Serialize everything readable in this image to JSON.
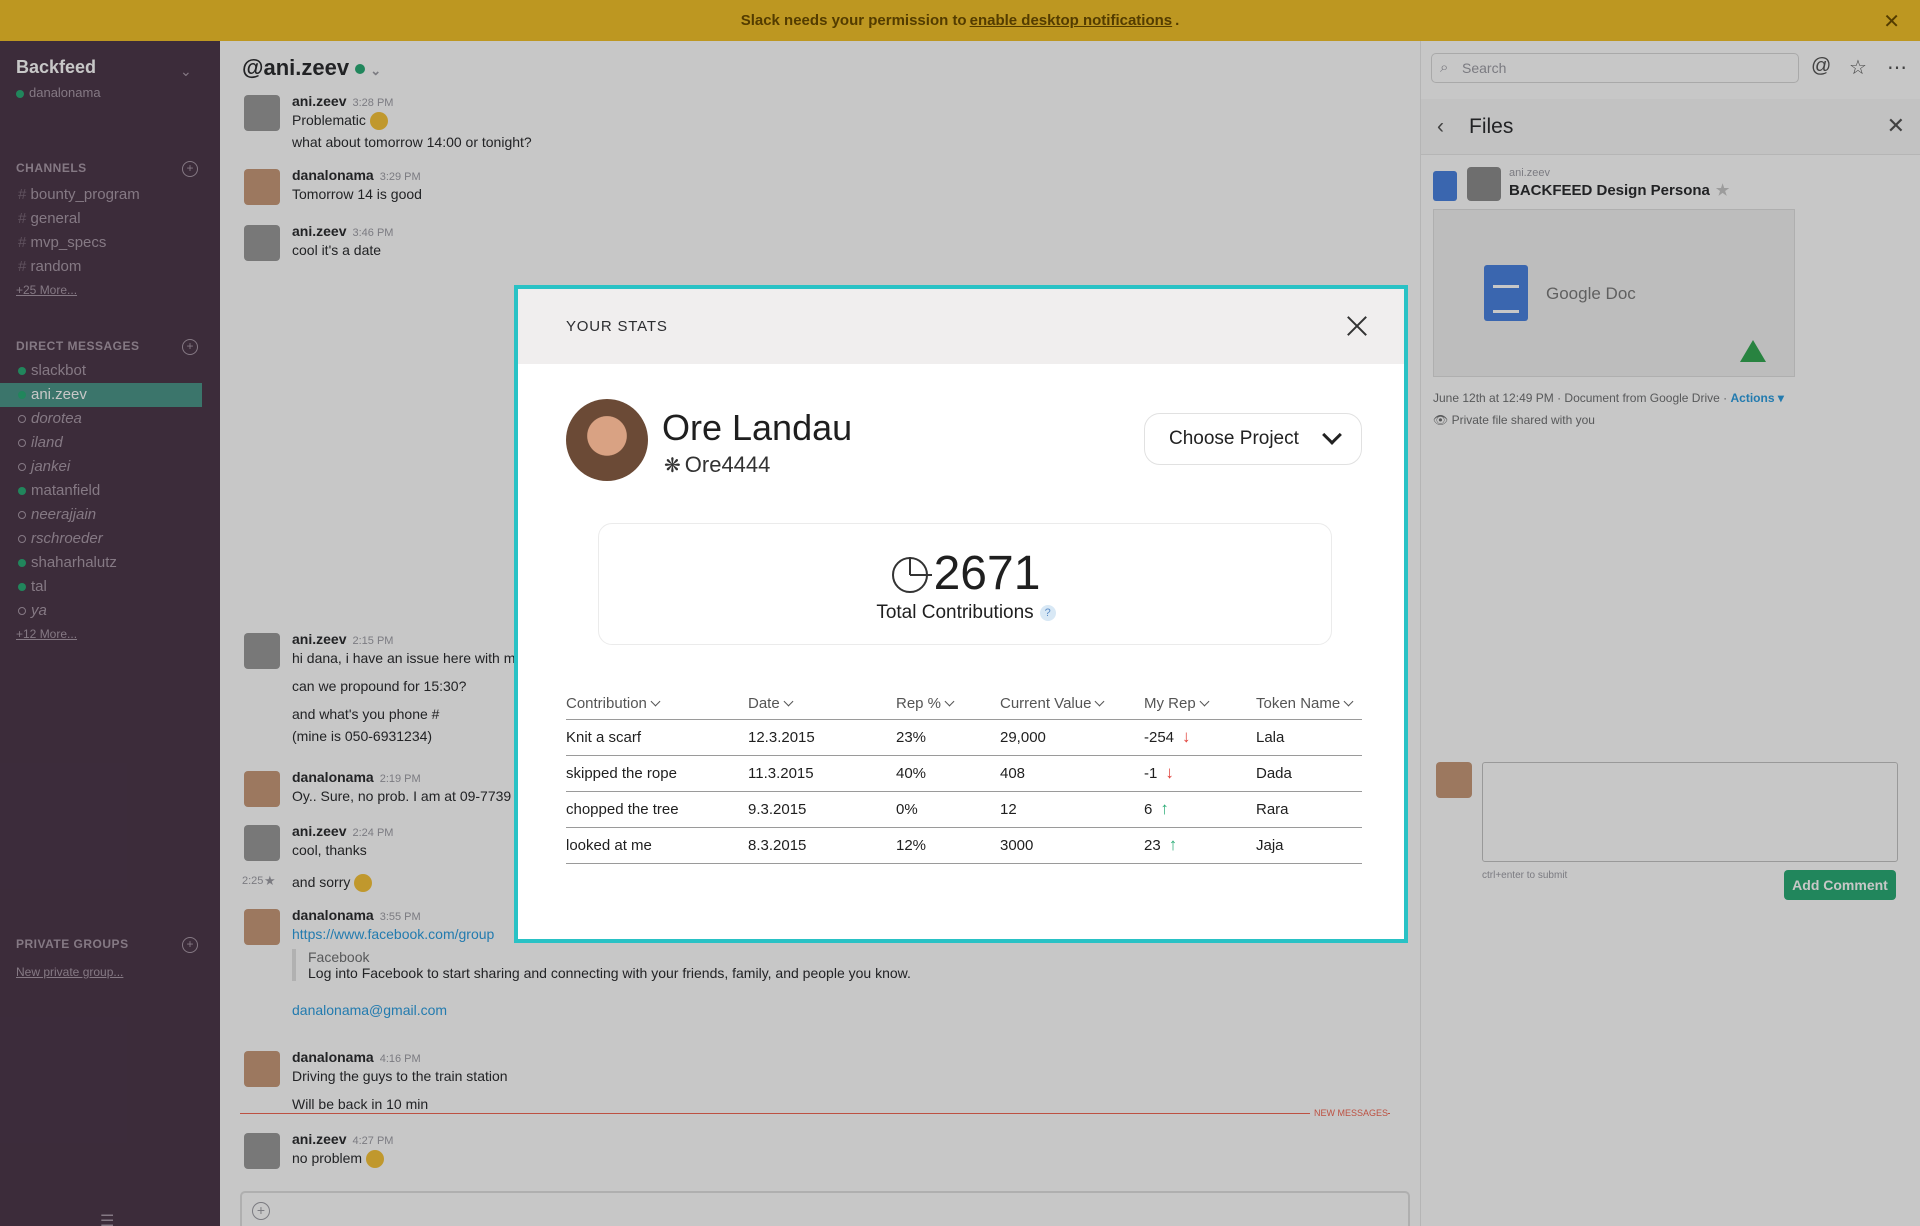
{
  "banner": {
    "text_before": "Slack needs your permission to",
    "link": "enable desktop notifications",
    "text_after": "."
  },
  "sidebar": {
    "team": "Backfeed",
    "user": "danalonama",
    "channels_title": "CHANNELS",
    "channels": [
      "bounty_program",
      "general",
      "mvp_specs",
      "random"
    ],
    "channels_more": "+25 More...",
    "dm_title": "DIRECT MESSAGES",
    "dms": [
      "slackbot",
      "ani.zeev",
      "dorotea",
      "iland",
      "jankei",
      "matanfield",
      "neerajjain",
      "rschroeder",
      "shaharhalutz",
      "tal",
      "ya"
    ],
    "dms_more": "+12 More...",
    "groups_title": "PRIVATE GROUPS",
    "groups_new": "New private group..."
  },
  "channel": {
    "name": "@ani.zeev"
  },
  "messages": [
    {
      "author": "ani.zeev",
      "time": "3:28 PM",
      "lines": [
        "Problematic",
        "what about tomorrow 14:00 or tonight?"
      ]
    },
    {
      "author": "danalonama",
      "time": "3:29 PM",
      "lines": [
        "Tomorrow 14 is good"
      ]
    },
    {
      "author": "ani.zeev",
      "time": "3:46 PM",
      "lines": [
        "cool it's a date"
      ]
    },
    {
      "author": "ani.zeev",
      "time": "2:15 PM",
      "lines": [
        "hi dana, i have an issue here with m",
        "can we propound for 15:30?",
        "and what's you phone #",
        "(mine is 050-6931234)"
      ]
    },
    {
      "author": "danalonama",
      "time": "2:19 PM",
      "lines": [
        "Oy.. Sure, no prob. I am at 09-7739"
      ]
    },
    {
      "author": "ani.zeev",
      "time": "2:24 PM",
      "lines": [
        "cool, thanks"
      ]
    },
    {
      "author": "",
      "time": "2:25",
      "lines": [
        "and sorry"
      ]
    },
    {
      "author": "danalonama",
      "time": "3:55 PM",
      "lines": [
        "https://www.facebook.com/group"
      ]
    },
    {
      "author": "",
      "time": "",
      "lines": [
        "danalonama@gmail.com"
      ]
    },
    {
      "author": "danalonama",
      "time": "4:16 PM",
      "lines": [
        "Driving the guys to the train station",
        "Will be back in 10 min"
      ]
    },
    {
      "author": "ani.zeev",
      "time": "4:27 PM",
      "lines": [
        "no problem"
      ]
    }
  ],
  "fb_preview": {
    "title": "Facebook",
    "text": "Log into Facebook to start sharing and connecting with your friends, family, and people you know."
  },
  "new_messages_label": "NEW MESSAGES",
  "right_panel": {
    "search_placeholder": "Search",
    "files_title": "Files",
    "file": {
      "owner": "ani.zeev",
      "title": "BACKFEED Design Persona",
      "preview_label": "Google Doc",
      "meta": "June 12th at 12:49 PM · Document from Google Drive ·",
      "actions": "Actions",
      "shared": "Private file shared with you"
    },
    "comment_hint": "ctrl+enter to submit",
    "comment_button": "Add Comment"
  },
  "modal": {
    "title": "YOUR STATS",
    "user_name": "Ore Landau",
    "user_handle": "Ore4444",
    "choose_project": "Choose Project",
    "total_value": "2671",
    "total_label": "Total Contributions",
    "help": "?",
    "columns": [
      "Contribution",
      "Date",
      "Rep %",
      "Current Value",
      "My Rep",
      "Token Name"
    ],
    "rows": [
      {
        "contribution": "Knit a scarf",
        "date": "12.3.2015",
        "rep_pct": "23%",
        "current_value": "29,000",
        "my_rep": "-254",
        "trend": "down",
        "token": "Lala"
      },
      {
        "contribution": "skipped the rope",
        "date": "11.3.2015",
        "rep_pct": "40%",
        "current_value": "408",
        "my_rep": "-1",
        "trend": "down",
        "token": "Dada"
      },
      {
        "contribution": "chopped the tree",
        "date": "9.3.2015",
        "rep_pct": "0%",
        "current_value": "12",
        "my_rep": "6",
        "trend": "up",
        "token": "Rara"
      },
      {
        "contribution": "looked at me",
        "date": "8.3.2015",
        "rep_pct": "12%",
        "current_value": "3000",
        "my_rep": "23",
        "trend": "up",
        "token": "Jaja"
      }
    ]
  },
  "colors": {
    "banner": "#f3c22b",
    "sidebar": "#4d394b",
    "modal_border": "#29c2c5",
    "trend_down": "#e0413a",
    "trend_up": "#2bac76"
  }
}
